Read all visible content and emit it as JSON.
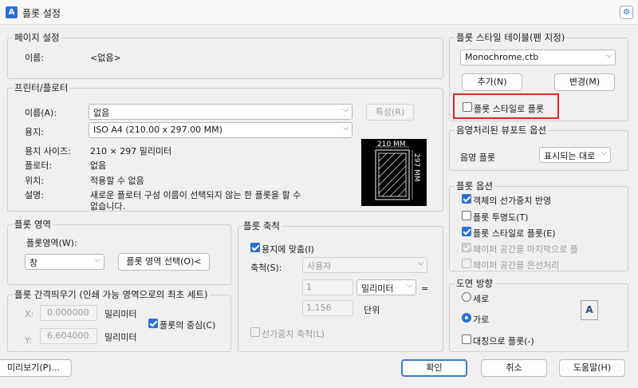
{
  "window": {
    "title": "플롯 설정",
    "app_icon": "A"
  },
  "page_setup": {
    "title": "페이지 설정",
    "name_label": "이름:",
    "name_value": "<없음>"
  },
  "printer": {
    "title": "프린터/플로터",
    "name_label": "이름(A):",
    "name_value": "없음",
    "properties_button": "특성(R)",
    "paper_label": "용지:",
    "paper_value": "ISO A4 (210.00 x 297.00 MM)",
    "paper_size_label": "용지 사이즈:",
    "paper_size_value": "210 × 297 밀리미터",
    "plotter_label": "플로터:",
    "plotter_value": "없음",
    "location_label": "위치:",
    "location_value": "적용할 수 없음",
    "description_label": "설명:",
    "description_line1": "새로운 플로터 구성 이름이 선택되지 않는 한 플롯을 할 수",
    "description_line2": "없습니다.",
    "preview_width": "210 MM",
    "preview_height": "297 MM"
  },
  "plot_area": {
    "title": "플롯 영역",
    "label": "플롯영역(W):",
    "value": "창",
    "select_button": "플롯 영역 선택(O)<"
  },
  "plot_offset": {
    "title": "플롯 간격띄우기 (인쇄 가능 영역으로의 최초 세트)",
    "x_label": "X:",
    "x_value": "0.000000",
    "x_unit": "밀리미터",
    "y_label": "Y:",
    "y_value": "6.604000",
    "y_unit": "밀리미터",
    "center_label": "플롯의 중심(C)"
  },
  "plot_scale": {
    "title": "플롯 축척",
    "fit_label": "용지에 맞춤(I)",
    "scale_label": "축척(S):",
    "scale_value": "사용자",
    "num_value": "1",
    "unit_value": "밀리미터",
    "equals": "=",
    "denom_value": "1.156",
    "denom_unit": "단위",
    "lineweight_label": "선가중치 축척(L)"
  },
  "plot_style_table": {
    "title": "플롯 스타일 테이블(펜 지정)",
    "value": "Monochrome.ctb",
    "add_button": "추가(N)",
    "edit_button": "변경(M)",
    "plot_with_styles": "플롯 스타일로 플롯"
  },
  "shaded_viewport": {
    "title": "음영처리된 뷰포트 옵션",
    "label": "음영 플롯",
    "value": "표시되는 대로"
  },
  "plot_options": {
    "title": "플롯 옵션",
    "lineweights": "객체의 선가중치 반영",
    "transparency": "플롯 투명도(T)",
    "plot_styles": "플롯 스타일로 플롯(E)",
    "paperspace_last": "페이퍼 공간을 마지막으로 플",
    "hide_paperspace": "페이퍼 공간을 은선처리"
  },
  "orientation": {
    "title": "도면 방향",
    "portrait": "세로",
    "landscape": "가로",
    "upside_down": "대칭으로 플롯(-)",
    "icon_glyph": "A"
  },
  "footer": {
    "preview": "미리보기(P)...",
    "ok": "확인",
    "cancel": "취소",
    "help": "도움말(H)"
  }
}
